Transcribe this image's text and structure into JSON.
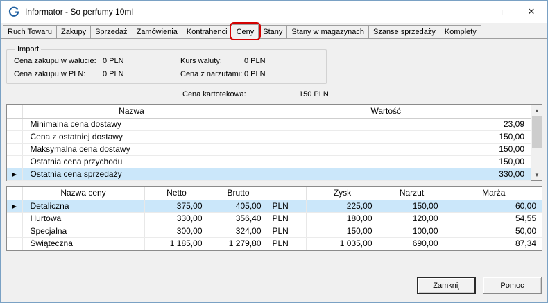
{
  "window": {
    "title": "Informator - So perfumy 10ml",
    "maximize_glyph": "□",
    "close_glyph": "✕"
  },
  "colors": {
    "annotation_red": "#d30000",
    "selection_blue": "#cbe7fa",
    "titlebar_bg": "#ffffff",
    "dialog_bg": "#f0f0f0"
  },
  "icons": {
    "row_marker": "▶",
    "scroll_up": "▲",
    "scroll_down": "▼"
  },
  "tabs": [
    {
      "label": "Ruch Towaru",
      "selected": false
    },
    {
      "label": "Zakupy",
      "selected": false
    },
    {
      "label": "Sprzedaż",
      "selected": false
    },
    {
      "label": "Zamówienia",
      "selected": false
    },
    {
      "label": "Kontrahenci",
      "selected": false
    },
    {
      "label": "Ceny",
      "selected": true,
      "annotated": true
    },
    {
      "label": "Stany",
      "selected": false
    },
    {
      "label": "Stany w magazynach",
      "selected": false
    },
    {
      "label": "Szanse sprzedaży",
      "selected": false
    },
    {
      "label": "Komplety",
      "selected": false
    }
  ],
  "import_group": {
    "title": "Import",
    "fields": [
      {
        "label": "Cena zakupu w walucie:",
        "value": "0 PLN"
      },
      {
        "label": "Kurs waluty:",
        "value": "0 PLN"
      },
      {
        "label": "Cena zakupu w PLN:",
        "value": "0 PLN"
      },
      {
        "label": "Cena z narzutami:",
        "value": "0 PLN"
      }
    ]
  },
  "cena_kartotekowa": {
    "label": "Cena kartotekowa:",
    "value": "150 PLN"
  },
  "price_table": {
    "headers": [
      "Nazwa",
      "Wartość"
    ],
    "rows": [
      {
        "name": "Minimalna cena dostawy",
        "value": "23,09",
        "selected": false
      },
      {
        "name": "Cena z ostatniej dostawy",
        "value": "150,00",
        "selected": false
      },
      {
        "name": "Maksymalna cena dostawy",
        "value": "150,00",
        "selected": false
      },
      {
        "name": "Ostatnia cena przychodu",
        "value": "150,00",
        "selected": false
      },
      {
        "name": "Ostatnia cena sprzedaży",
        "value": "330,00",
        "selected": true
      }
    ]
  },
  "sales_table": {
    "headers": [
      "Nazwa ceny",
      "Netto",
      "Brutto",
      "",
      "Zysk",
      "Narzut",
      "Marża"
    ],
    "rows": [
      {
        "cells": [
          "Detaliczna",
          "375,00",
          "405,00",
          "PLN",
          "225,00",
          "150,00",
          "60,00"
        ],
        "selected": true
      },
      {
        "cells": [
          "Hurtowa",
          "330,00",
          "356,40",
          "PLN",
          "180,00",
          "120,00",
          "54,55"
        ],
        "selected": false
      },
      {
        "cells": [
          "Specjalna",
          "300,00",
          "324,00",
          "PLN",
          "150,00",
          "100,00",
          "50,00"
        ],
        "selected": false
      },
      {
        "cells": [
          "Świąteczna",
          "1 185,00",
          "1 279,80",
          "PLN",
          "1 035,00",
          "690,00",
          "87,34"
        ],
        "selected": false
      }
    ]
  },
  "buttons": {
    "close_label": "Zamknij",
    "help_label": "Pomoc"
  }
}
